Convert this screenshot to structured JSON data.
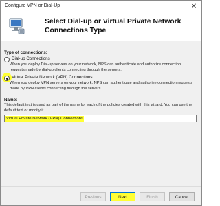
{
  "window": {
    "title": "Configure VPN or Dial-Up",
    "close_glyph": "✕"
  },
  "header": {
    "title": "Select Dial-up or Virtual Private Network Connections Type"
  },
  "connections": {
    "label": "Type of connections:",
    "options": [
      {
        "label": "Dial-up Connections",
        "selected": false,
        "description": "When you deploy Dial-up servers on your network, NPS can authenticate and authorize connection requests made by dial-up clients connecting through the servers."
      },
      {
        "label": "Virtual Private Network (VPN) Connections",
        "selected": true,
        "description": "When you deploy VPN servers on your network, NPS can authenticate and authorize connection requests made by VPN clients connecting through the servers."
      }
    ]
  },
  "name": {
    "label": "Name:",
    "description": "This default text is used as part of the name for each of the policies created with this wizard. You can use the default text or modify it .",
    "value": "Virtual Private Network (VPN) Connections"
  },
  "buttons": {
    "previous": "Previous",
    "next": "Next",
    "finish": "Finish",
    "cancel": "Cancel"
  },
  "colors": {
    "highlight": "#ffff33",
    "accent": "#0078d7"
  },
  "icons": {
    "header": "network-connection-icon"
  }
}
